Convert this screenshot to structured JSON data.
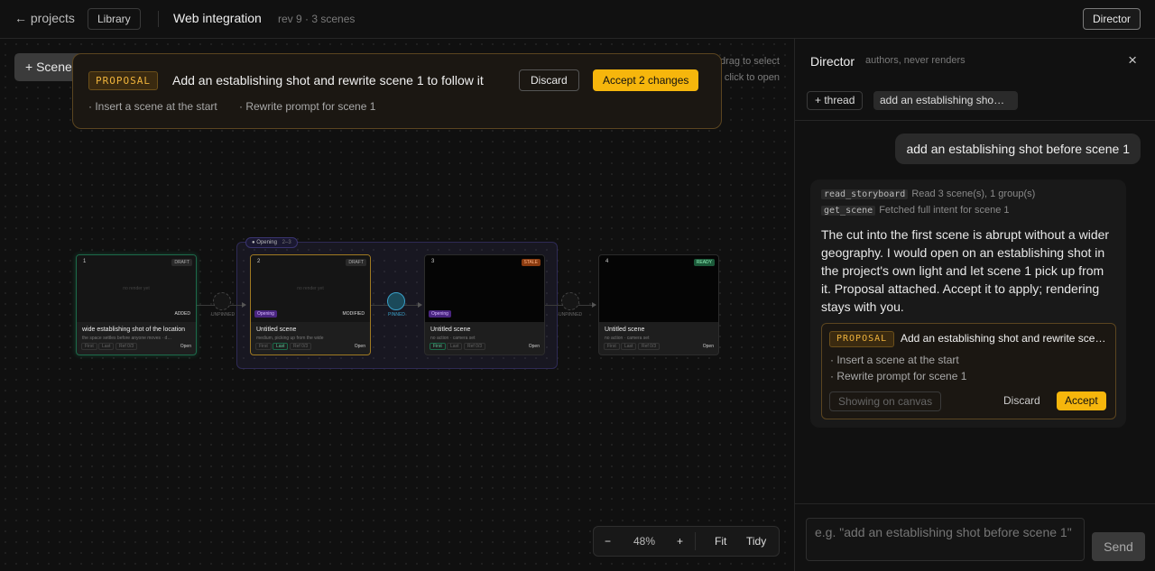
{
  "topbar": {
    "back_label": "projects",
    "library_label": "Library",
    "project_title": "Web integration",
    "project_meta": "rev 9 · 3 scenes",
    "director_label": "Director"
  },
  "canvas": {
    "add_scene_label": "+ Scene",
    "hint_line1": "drag to select",
    "hint_line2": "click to open",
    "proposal": {
      "tag": "PROPOSAL",
      "title": "Add an establishing shot and rewrite scene 1 to follow it",
      "discard_label": "Discard",
      "accept_label": "Accept 2 changes",
      "items": [
        "· Insert a scene at the start",
        "· Rewrite prompt for scene 1"
      ]
    },
    "group": {
      "label": "Opening",
      "range": "2–3"
    },
    "scenes": [
      {
        "num": "1",
        "status": "DRAFT",
        "placeholder": "no render yet",
        "corner_badge": "ADDED",
        "title": "wide establishing shot of the location",
        "subtitle": "the space settles before anyone moves · d…",
        "pills": [
          "First",
          "Last",
          "Ref 0/3"
        ],
        "open_label": "Open"
      },
      {
        "num": "2",
        "status": "DRAFT",
        "placeholder": "no render yet",
        "group_badge": "Opening",
        "corner_badge": "MODIFIED",
        "title": "Untitled scene",
        "subtitle": "medium, picking up from the wide",
        "pills": [
          "First",
          "Last",
          "Ref 0/3"
        ],
        "open_label": "Open"
      },
      {
        "num": "3",
        "status": "STALE",
        "group_badge": "Opening",
        "title": "Untitled scene",
        "subtitle": "no action · camera set",
        "pills": [
          "First",
          "Last",
          "Ref 0/3"
        ],
        "open_label": "Open"
      },
      {
        "num": "4",
        "status": "READY",
        "title": "Untitled scene",
        "subtitle": "no action · camera set",
        "pills": [
          "First",
          "Last",
          "Ref 0/3"
        ],
        "open_label": "Open"
      }
    ],
    "links": [
      {
        "label": "UNPINNED"
      },
      {
        "label": "PINNED"
      },
      {
        "label": "UNPINNED"
      }
    ],
    "zoom": {
      "minus": "−",
      "level": "48%",
      "plus": "+",
      "fit": "Fit",
      "tidy": "Tidy"
    }
  },
  "panel": {
    "title": "Director",
    "subtitle": "authors, never renders",
    "close_icon": "×",
    "thread_add_label": "+ thread",
    "thread_tab_label": "add an establishing sho…",
    "user_message": "add an establishing shot before scene 1",
    "tools": [
      {
        "name": "read_storyboard",
        "result": "Read 3 scene(s), 1 group(s)"
      },
      {
        "name": "get_scene",
        "result": "Fetched full intent for scene 1"
      }
    ],
    "assistant_text": "The cut into the first scene is abrupt without a wider geography. I would open on an establishing shot in the project's own light and let scene 1 pick up from it. Proposal attached. Accept it to apply; rendering stays with you.",
    "proposal": {
      "tag": "PROPOSAL",
      "title": "Add an establishing shot and rewrite scene 1 to follow it",
      "items": [
        "· Insert a scene at the start",
        "· Rewrite prompt for scene 1"
      ],
      "showing_label": "Showing on canvas",
      "discard_label": "Discard",
      "accept_label": "Accept"
    },
    "composer_placeholder": "e.g. \"add an establishing shot before scene 1\"",
    "send_label": "Send"
  },
  "colors": {
    "accent": "#f6b60c",
    "proposal_border": "#5b4520",
    "group_badge": "#4a2580",
    "ready": "#1c5a3a",
    "stale": "#8a3b10"
  }
}
